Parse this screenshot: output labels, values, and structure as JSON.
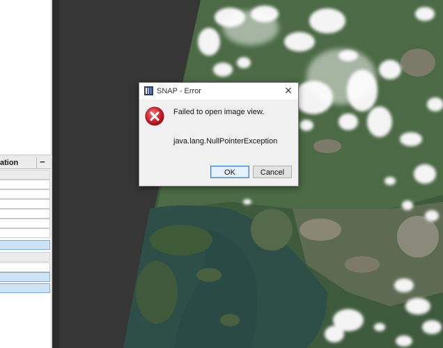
{
  "left_panel": {
    "column_header": "ation",
    "collapse_symbol": "−"
  },
  "dialog": {
    "title": "SNAP - Error",
    "close_symbol": "✕",
    "message": "Failed to open image view.",
    "detail": "java.lang.NullPointerException",
    "ok_label": "OK",
    "cancel_label": "Cancel",
    "icon": "error-icon"
  },
  "colors": {
    "error_red": "#d9232e",
    "ok_border": "#3c7fd1",
    "selected_row": "#cfe3f7"
  }
}
